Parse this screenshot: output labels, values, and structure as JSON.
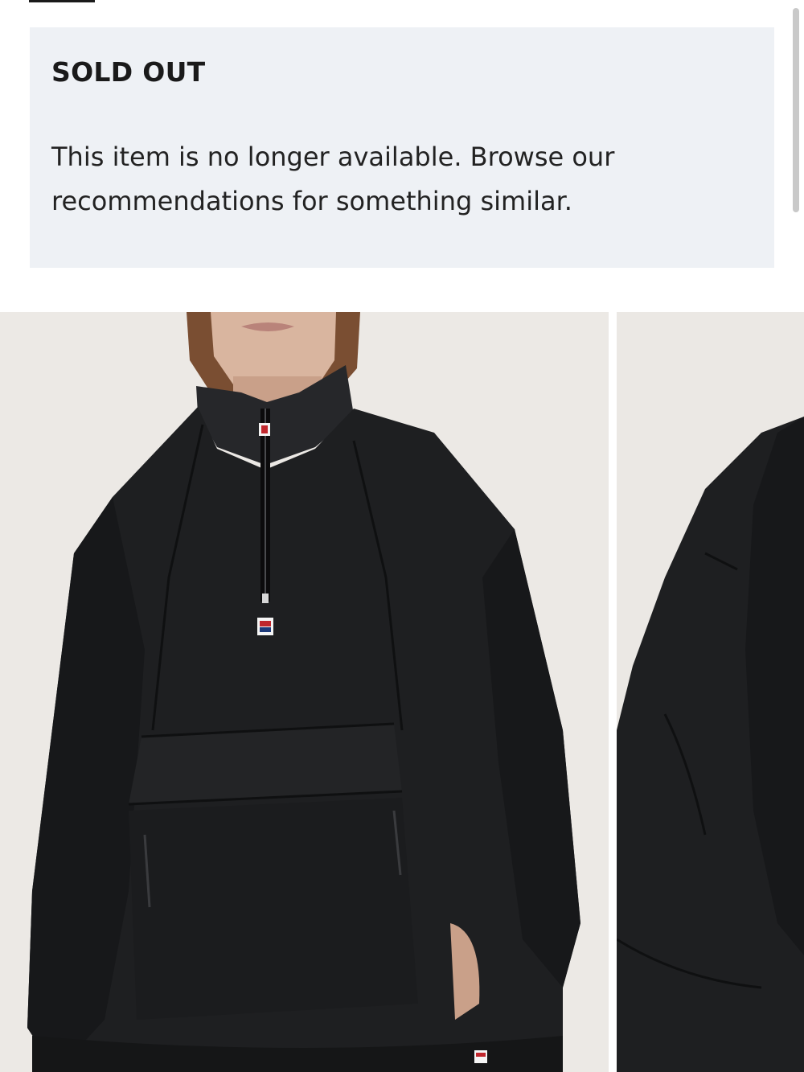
{
  "notice": {
    "title": "SOLD OUT",
    "message": "This item is no longer available. Browse our recommendations for something similar."
  },
  "gallery": {
    "images": [
      {
        "name": "product-photo-front",
        "subject": "black half-zip anorak jacket, front view"
      },
      {
        "name": "product-photo-side",
        "subject": "black half-zip anorak jacket, side view"
      }
    ]
  },
  "colors": {
    "notice_background": "#eef1f5",
    "text": "#1a1a1a",
    "photo_background": "#ece9e5",
    "jacket": "#1c1d1f"
  }
}
